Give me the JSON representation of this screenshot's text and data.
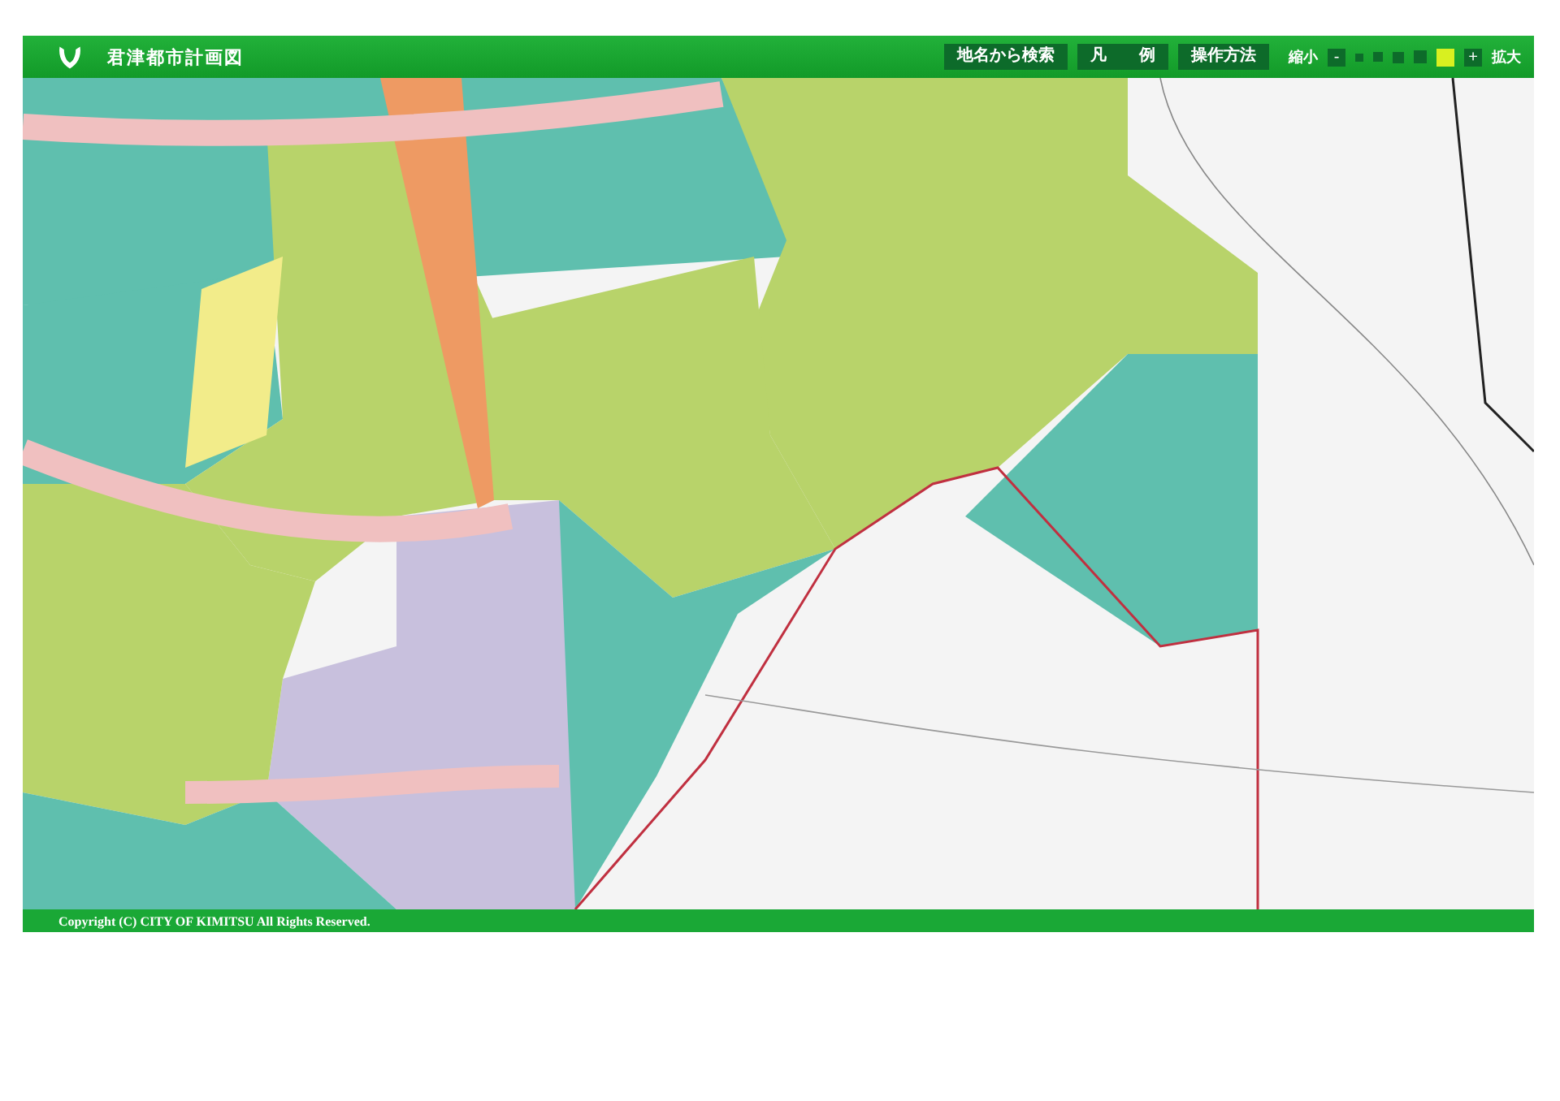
{
  "header": {
    "title": "君津都市計画図",
    "buttons": [
      {
        "label": "地名から検索"
      },
      {
        "label": "凡　　例"
      },
      {
        "label": "操作方法"
      }
    ],
    "zoom": {
      "out_label": "縮小",
      "out_button": "-",
      "in_button": "+",
      "in_label": "拡大",
      "levels": [
        {
          "selected": false
        },
        {
          "selected": false
        },
        {
          "selected": false
        },
        {
          "selected": false
        },
        {
          "selected": true
        }
      ]
    }
  },
  "footer": {
    "copyright": "Copyright (C) CITY OF KIMITSU All Rights Reserved."
  }
}
